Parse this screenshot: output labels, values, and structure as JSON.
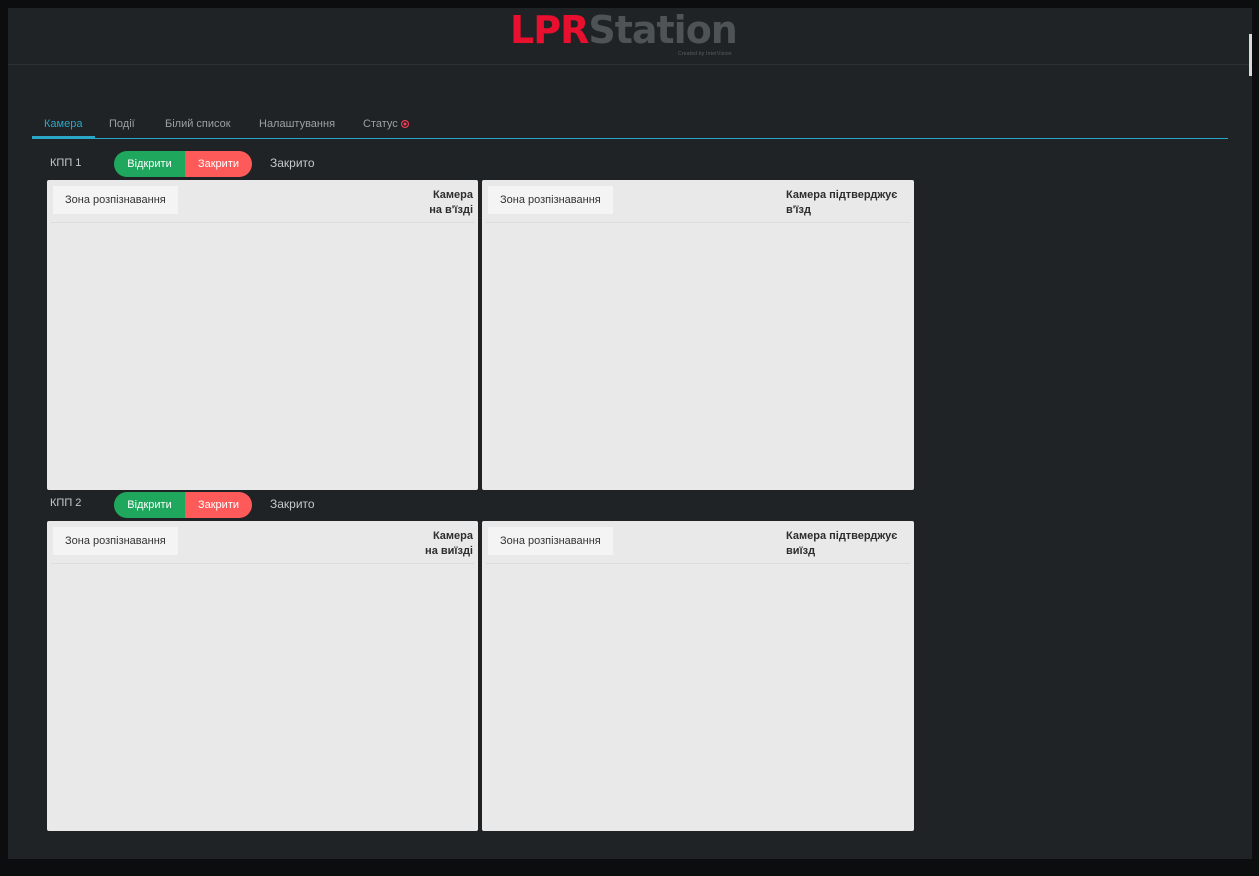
{
  "brand": {
    "logo_part1": "LPR",
    "logo_part2": "Station",
    "tagline": "Created by InterVision"
  },
  "tabs": [
    {
      "label": "Камера",
      "active": true
    },
    {
      "label": "Події",
      "active": false
    },
    {
      "label": "Білий список",
      "active": false
    },
    {
      "label": "Налаштування",
      "active": false
    },
    {
      "label": "Статус",
      "active": false,
      "indicator": "status-error-dot"
    }
  ],
  "checkpoints": [
    {
      "name": "КПП 1",
      "open_label": "Відкрити",
      "close_label": "Закрити",
      "status": "Закрито",
      "cameras": [
        {
          "zone_button": "Зона розпізнавання",
          "title": "Камера\nна в'їзді"
        },
        {
          "zone_button": "Зона розпізнавання",
          "title": "Камера підтверджує\nв'їзд"
        }
      ]
    },
    {
      "name": "КПП 2",
      "open_label": "Відкрити",
      "close_label": "Закрити",
      "status": "Закрито",
      "cameras": [
        {
          "zone_button": "Зона розпізнавання",
          "title": "Камера\nна виїзді"
        },
        {
          "zone_button": "Зона розпізнавання",
          "title": "Камера підтверджує\nвиїзд"
        }
      ]
    }
  ],
  "colors": {
    "accent": "#2aa6c6",
    "open": "#1fa85d",
    "close": "#ff5a5a",
    "logo_red": "#e8102e",
    "logo_grey": "#4e5356",
    "background": "#1f2326",
    "panel": "#e9e9e9"
  }
}
